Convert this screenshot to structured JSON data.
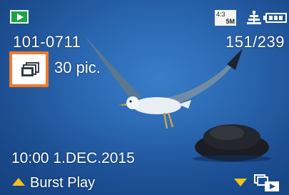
{
  "status_bar": {
    "mode_icon": "playback-icon",
    "aspect_ratio": "4:3",
    "picture_size": "5M",
    "quality_icon": "quality-fine-icon",
    "battery_icon": "battery-icon"
  },
  "file_info": {
    "folder_file_number": "101-0711",
    "counter": "151/239"
  },
  "burst": {
    "group_icon": "burst-group-icon",
    "picture_count": "30 pic."
  },
  "datetime": "10:00  1.DEC.2015",
  "footer": {
    "up_hint_label": "Burst Play",
    "up_arrow_icon": "up-arrow-icon",
    "down_arrow_icon": "down-arrow-icon",
    "down_action_icon": "playback-mode-icon"
  },
  "colors": {
    "highlight_border": "#f07a2a",
    "arrow": "#f2c21a",
    "play_icon_bg": "#1fa24a",
    "text": "#ffffff"
  }
}
